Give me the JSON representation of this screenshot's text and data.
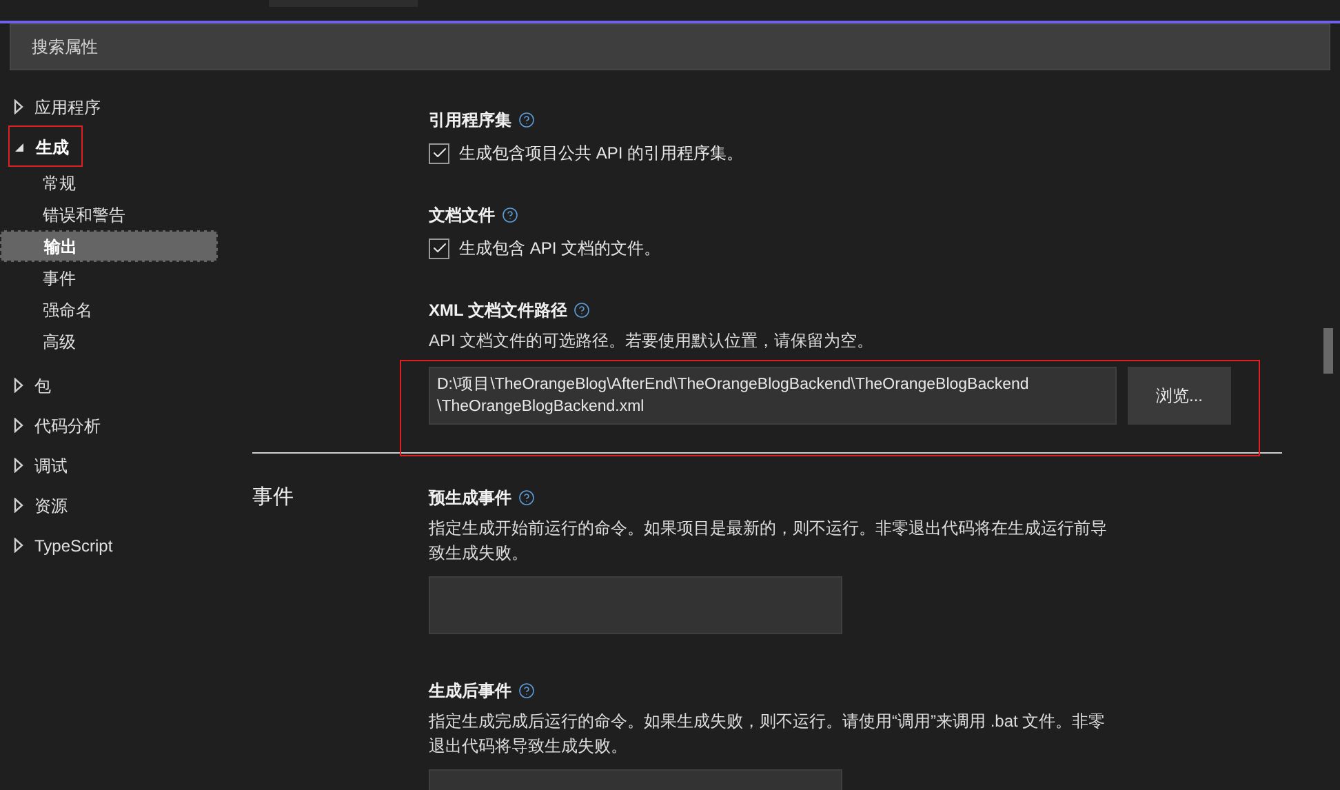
{
  "search": {
    "placeholder": "搜索属性"
  },
  "sidebar": {
    "items": [
      {
        "label": "应用程序",
        "expanded": false
      },
      {
        "label": "生成",
        "expanded": true,
        "children": [
          {
            "label": "常规",
            "selected": false
          },
          {
            "label": "错误和警告",
            "selected": false
          },
          {
            "label": "输出",
            "selected": true
          },
          {
            "label": "事件",
            "selected": false
          },
          {
            "label": "强命名",
            "selected": false
          },
          {
            "label": "高级",
            "selected": false
          }
        ]
      },
      {
        "label": "包",
        "expanded": false
      },
      {
        "label": "代码分析",
        "expanded": false
      },
      {
        "label": "调试",
        "expanded": false
      },
      {
        "label": "资源",
        "expanded": false
      },
      {
        "label": "TypeScript",
        "expanded": false
      }
    ]
  },
  "sections": [
    {
      "settings": [
        {
          "kind": "checkbox",
          "title": "引用程序集",
          "label": "生成包含项目公共 API 的引用程序集。",
          "checked": true
        },
        {
          "kind": "checkbox",
          "title": "文档文件",
          "label": "生成包含 API 文档的文件。",
          "checked": true
        },
        {
          "kind": "path",
          "title": "XML 文档文件路径",
          "description": "API 文档文件的可选路径。若要使用默认位置，请保留为空。",
          "value_lines": [
            "D:\\项目\\TheOrangeBlog\\AfterEnd\\TheOrangeBlogBackend\\TheOrangeBlogBackend",
            "\\TheOrangeBlogBackend.xml"
          ],
          "button": "浏览..."
        }
      ]
    },
    {
      "title": "事件",
      "settings": [
        {
          "kind": "text",
          "title": "预生成事件",
          "description": "指定生成开始前运行的命令。如果项目是最新的，则不运行。非零退出代码将在生成运行前导致生成失败。"
        },
        {
          "kind": "text",
          "title": "生成后事件",
          "description": "指定生成完成后运行的命令。如果生成失败，则不运行。请使用“调用”来调用 .bat 文件。非零退出代码将导致生成失败。"
        }
      ]
    }
  ]
}
